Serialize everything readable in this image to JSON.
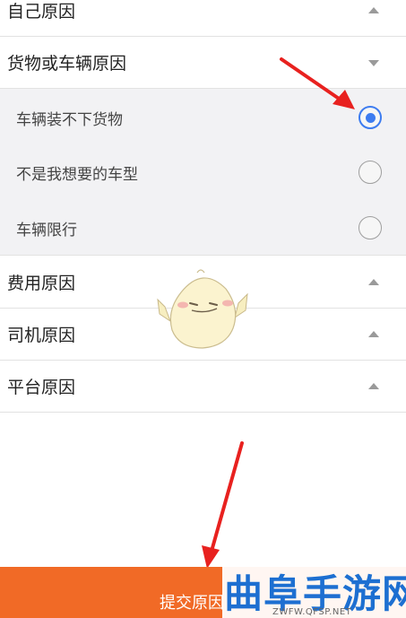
{
  "sections": [
    {
      "label": "自己原因",
      "state": "collapsed"
    },
    {
      "label": "货物或车辆原因",
      "state": "expanded"
    },
    {
      "label": "费用原因",
      "state": "collapsed"
    },
    {
      "label": "司机原因",
      "state": "collapsed"
    },
    {
      "label": "平台原因",
      "state": "collapsed"
    }
  ],
  "options": [
    {
      "label": "车辆装不下货物",
      "selected": true
    },
    {
      "label": "不是我想要的车型",
      "selected": false
    },
    {
      "label": "车辆限行",
      "selected": false
    }
  ],
  "submit": {
    "label": "提交原因"
  },
  "watermark": {
    "title": "曲阜手游网",
    "url": "ZWFW.QFSP.NET"
  },
  "colors": {
    "accent_orange": "#f16a26",
    "radio_blue": "#3d7cf0",
    "arrow_red": "#e8211f",
    "watermark_blue": "#1d6fd1"
  }
}
